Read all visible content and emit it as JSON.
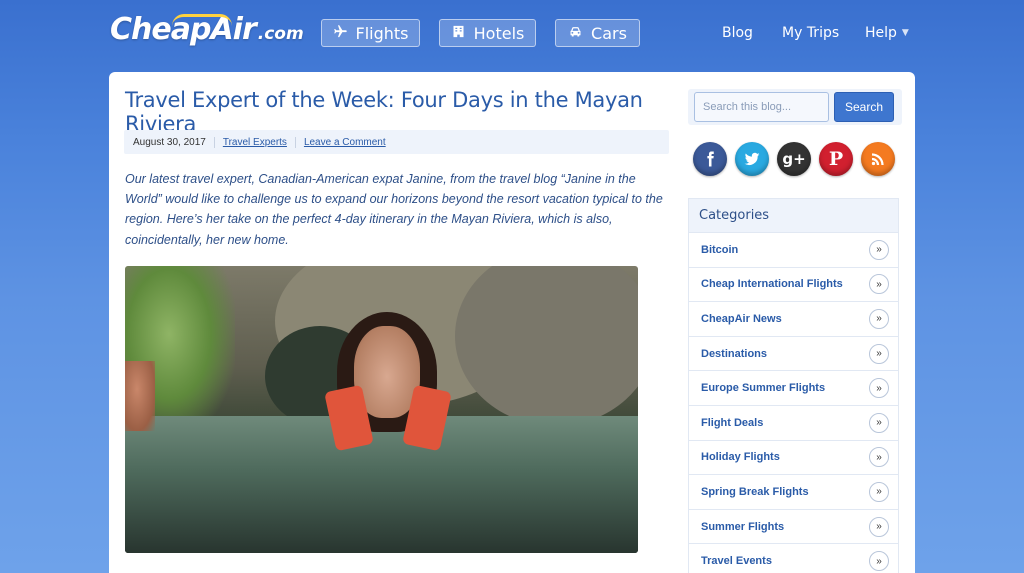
{
  "header": {
    "logo_main": "CheapAir",
    "logo_tld": ".com",
    "nav": [
      {
        "label": "Flights",
        "icon": "airplane-icon"
      },
      {
        "label": "Hotels",
        "icon": "building-icon"
      },
      {
        "label": "Cars",
        "icon": "car-icon"
      }
    ],
    "links": {
      "blog": "Blog",
      "my_trips": "My Trips",
      "help": "Help"
    }
  },
  "post": {
    "title": "Travel Expert of the Week: Four Days in the Mayan Riviera",
    "date": "August 30, 2017",
    "category_link": "Travel Experts",
    "comment_link": "Leave a Comment",
    "intro": "Our latest travel expert, Canadian-American expat Janine, from the travel blog “Janine in the World” would like to challenge us to expand our horizons beyond the resort vacation typical to the region. Here’s her take on the perfect 4-day itinerary in the Mayan Riviera, which is also, coincidentally, her new home."
  },
  "sidebar": {
    "search": {
      "placeholder": "Search this blog...",
      "button": "Search"
    },
    "social": [
      {
        "name": "facebook-icon",
        "color": "#3b5998"
      },
      {
        "name": "twitter-icon",
        "color": "#29a9e1"
      },
      {
        "name": "google-plus-icon",
        "color": "#333333"
      },
      {
        "name": "pinterest-icon",
        "color": "#d1202f"
      },
      {
        "name": "rss-icon",
        "color": "#f47a20"
      }
    ],
    "categories_title": "Categories",
    "categories": [
      {
        "label": "Bitcoin"
      },
      {
        "label": "Cheap International Flights"
      },
      {
        "label": "CheapAir News"
      },
      {
        "label": "Destinations"
      },
      {
        "label": "Europe Summer Flights"
      },
      {
        "label": "Flight Deals"
      },
      {
        "label": "Holiday Flights"
      },
      {
        "label": "Spring Break Flights"
      },
      {
        "label": "Summer Flights"
      },
      {
        "label": "Travel Events"
      }
    ],
    "arrow": "»"
  },
  "colors": {
    "accent": "#2a5ba8",
    "header_bg": "#3a70cf",
    "search_button": "#3e76cf"
  }
}
